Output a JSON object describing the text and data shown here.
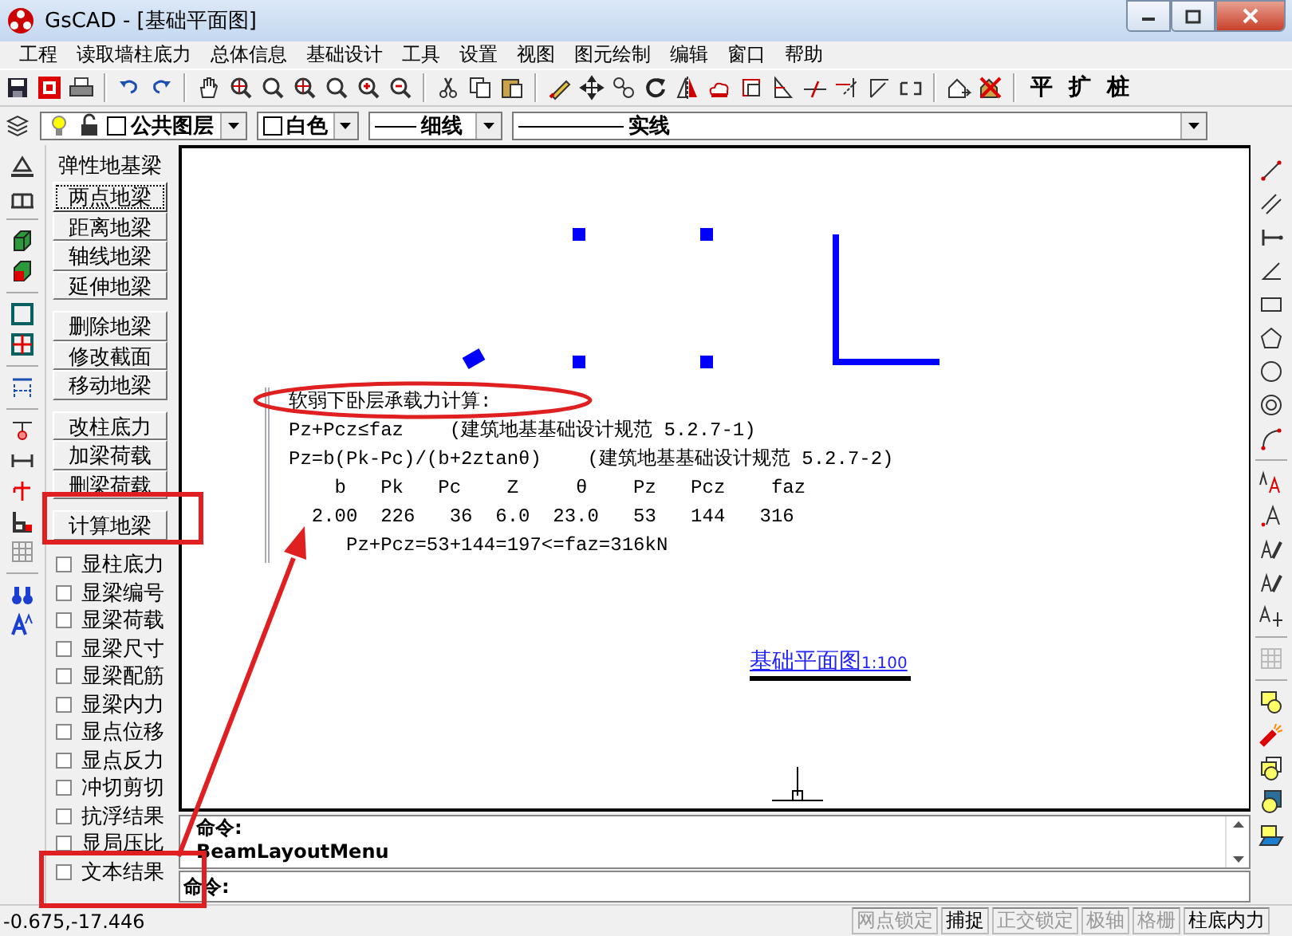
{
  "window": {
    "title": "GsCAD - [基础平面图]"
  },
  "menu": [
    "工程",
    "读取墙柱底力",
    "总体信息",
    "基础设计",
    "工具",
    "设置",
    "视图",
    "图元绘制",
    "编辑",
    "窗口",
    "帮助"
  ],
  "toolbar": {
    "text_buttons": [
      "平",
      "扩",
      "桩"
    ]
  },
  "layer_bar": {
    "layer": "公共图层",
    "pen": "白色",
    "line_weight": "细线",
    "line_type": "实线"
  },
  "beam_panel": {
    "heading": "弹性地基梁",
    "button_groups": [
      [
        {
          "label": "两点地梁",
          "selected": true
        },
        {
          "label": "距离地梁",
          "selected": false
        },
        {
          "label": "轴线地梁",
          "selected": false
        },
        {
          "label": "延伸地梁",
          "selected": false
        }
      ],
      [
        {
          "label": "删除地梁",
          "selected": false
        },
        {
          "label": "修改截面",
          "selected": false
        },
        {
          "label": "移动地梁",
          "selected": false
        }
      ],
      [
        {
          "label": "改柱底力",
          "selected": false
        },
        {
          "label": "加梁荷载",
          "selected": false
        },
        {
          "label": "删梁荷载",
          "selected": false
        }
      ],
      [
        {
          "label": "计算地梁",
          "selected": false
        }
      ]
    ],
    "checkboxes": [
      {
        "label": "显柱底力",
        "checked": false
      },
      {
        "label": "显梁编号",
        "checked": false
      },
      {
        "label": "显梁荷载",
        "checked": false
      },
      {
        "label": "显梁尺寸",
        "checked": false
      },
      {
        "label": "显梁配筋",
        "checked": false
      },
      {
        "label": "显梁内力",
        "checked": false
      },
      {
        "label": "显点位移",
        "checked": false
      },
      {
        "label": "显点反力",
        "checked": false
      },
      {
        "label": "冲切剪切",
        "checked": false
      },
      {
        "label": "抗浮结果",
        "checked": false
      },
      {
        "label": "显局压比",
        "checked": false
      },
      {
        "label": "文本结果",
        "checked": false
      }
    ]
  },
  "canvas": {
    "text_output": [
      "软弱下卧层承载力计算:",
      "Pz+Pcz≤faz    (建筑地基基础设计规范 5.2.7-1)",
      "Pz=b(Pk-Pc)/(b+2ztanθ)    (建筑地基基础设计规范 5.2.7-2)",
      "    b   Pk   Pc    Z     θ    Pz   Pcz    faz",
      "  2.00  226   36  6.0  23.0   53   144   316",
      "     Pz+Pcz=53+144=197<=faz=316kN"
    ],
    "drawing_title": "基础平面图",
    "drawing_scale": "1:100"
  },
  "command": {
    "history": [
      "命令:",
      "BeamLayoutMenu"
    ],
    "prompt": "命令:"
  },
  "status_bar": {
    "coordinates": "-0.675,-17.446",
    "panes": [
      {
        "label": "网点锁定",
        "on": false
      },
      {
        "label": "捕捉",
        "on": true
      },
      {
        "label": "正交锁定",
        "on": false
      },
      {
        "label": "极轴",
        "on": false
      },
      {
        "label": "格栅",
        "on": false
      },
      {
        "label": "柱底内力",
        "on": true
      }
    ]
  }
}
